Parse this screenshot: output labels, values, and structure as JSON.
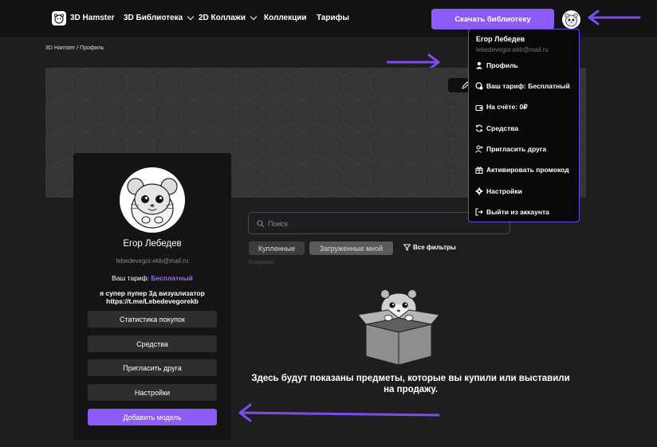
{
  "header": {
    "brand": "3D Hamster",
    "nav": [
      {
        "label": "3D Библиотека"
      },
      {
        "label": "2D Коллажи"
      },
      {
        "label": "Коллекции"
      },
      {
        "label": "Тарифы"
      }
    ],
    "download_label": "Скачать библиотеку"
  },
  "breadcrumb": "3D Hamster / Профиль",
  "profile": {
    "name": "Егор Лебедев",
    "email": "lebedevegor.ekb@mail.ru",
    "tariff_label": "Ваш тариф:",
    "tariff_value": "Бесплатный",
    "bio_line1": "я супер пупер 3д визуализатор",
    "bio_line2": "https://t.me/Lebedevegorekb",
    "buttons": [
      "Статистика покупок",
      "Средства",
      "Пригласить друга",
      "Настройки"
    ],
    "add_model_label": "Добавить модель"
  },
  "search": {
    "placeholder": "Поиск"
  },
  "filters": {
    "tabs": [
      "Купленные",
      "Загруженные мной"
    ],
    "all_filters": "Все фильтры",
    "count": "0 моделей"
  },
  "empty_state": {
    "line1": "Здесь будут показаны предметы, которые вы купили или выставили",
    "line2": "на продажу."
  },
  "dropdown": {
    "name": "Егор Лебедев",
    "email": "lebedevegor.ekb@mail.ru",
    "items": [
      {
        "label": "Профиль",
        "icon": "user-icon"
      },
      {
        "label": "Ваш тариф: Бесплатный",
        "icon": "tariff-icon"
      },
      {
        "label": "На счёте: 0₽",
        "icon": "wallet-icon"
      },
      {
        "label": "Средства",
        "icon": "refresh-icon"
      },
      {
        "label": "Пригласить друга",
        "icon": "invite-icon"
      },
      {
        "label": "Активировать промокод",
        "icon": "gift-icon"
      },
      {
        "label": "Настройки",
        "icon": "gear-icon"
      },
      {
        "label": "Выйти из аккаунта",
        "icon": "logout-icon"
      }
    ]
  },
  "colors": {
    "accent": "#8b5cf6",
    "background": "#1e1e20",
    "topbar": "#121214",
    "card": "#141416",
    "annotation_arrow": "#7c4dea"
  }
}
